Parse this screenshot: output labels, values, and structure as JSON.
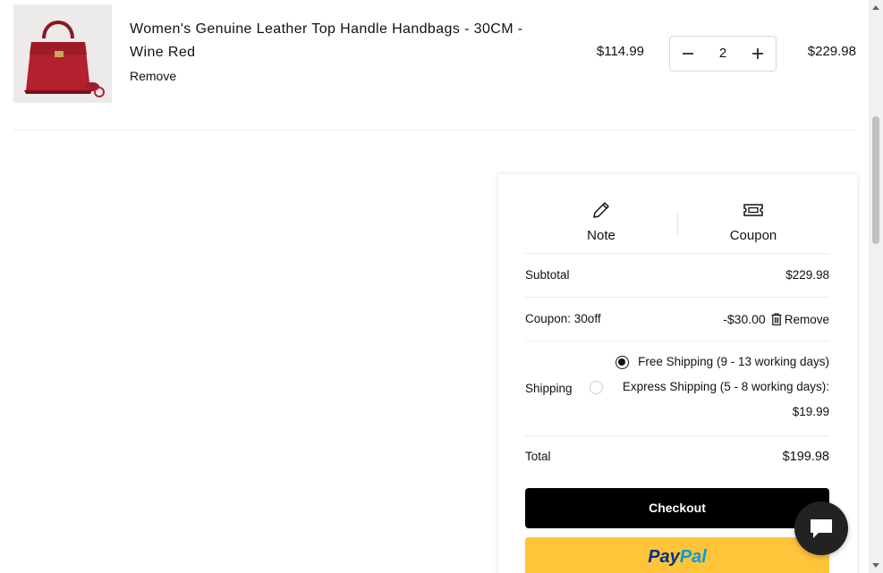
{
  "item": {
    "title": "Women's Genuine Leather Top Handle Handbags - 30CM - Wine Red",
    "remove_label": "Remove",
    "unit_price": "$114.99",
    "quantity": "2",
    "line_total": "$229.98",
    "image_icon": "red-handbag-image"
  },
  "summary": {
    "tabs": [
      {
        "label": "Note",
        "icon": "pencil-icon"
      },
      {
        "label": "Coupon",
        "icon": "ticket-icon"
      }
    ],
    "subtotal_label": "Subtotal",
    "subtotal_value": "$229.98",
    "coupon_label": "Coupon: 30off",
    "coupon_value": "-$30.00",
    "coupon_remove": "Remove",
    "shipping_label": "Shipping",
    "shipping_options": [
      {
        "label": "Free Shipping (9 - 13 working days)",
        "selected": true
      },
      {
        "label": "Express Shipping (5 - 8 working days): $19.99",
        "selected": false
      }
    ],
    "total_label": "Total",
    "total_value": "$199.98",
    "checkout_label": "Checkout",
    "paypal_part1": "Pay",
    "paypal_part2": "Pal"
  },
  "colors": {
    "checkout_bg": "#000000",
    "paypal_bg": "#ffc439",
    "paypal_dark": "#003087",
    "paypal_light": "#009cde",
    "handbag": "#b3202e"
  }
}
